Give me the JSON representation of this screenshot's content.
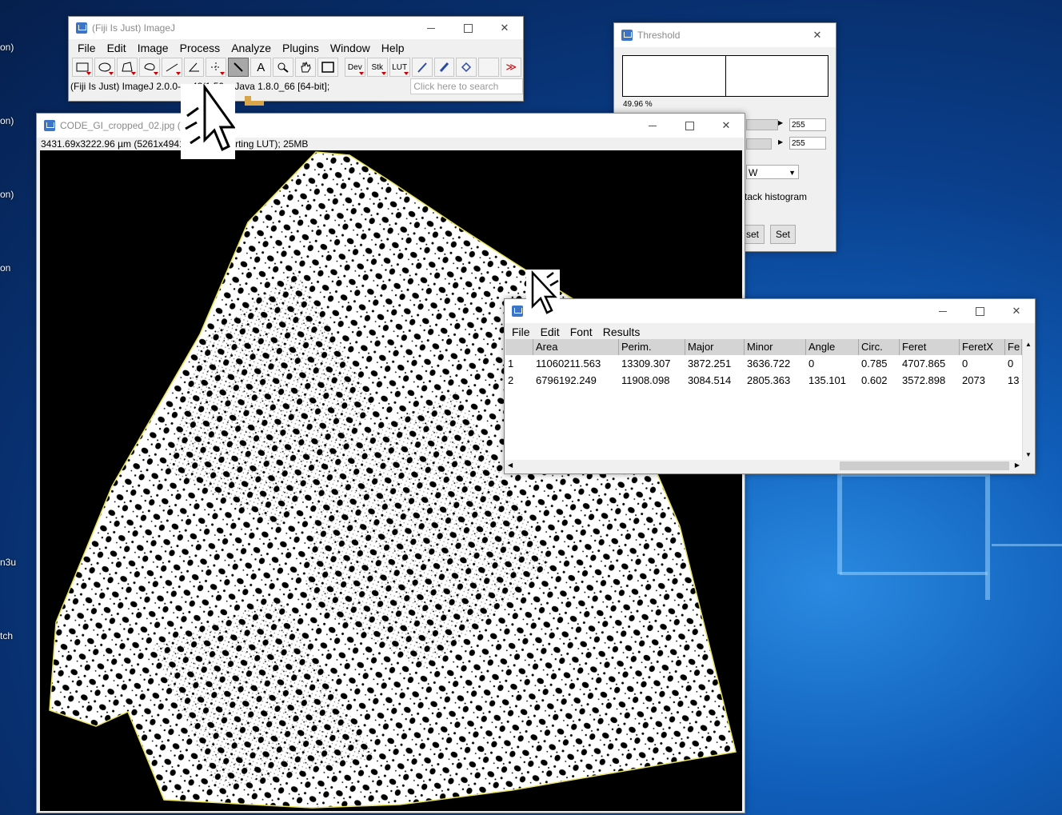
{
  "desktop": {
    "icon_labels": [
      "on)",
      "on)",
      "on)",
      "on",
      "n3u",
      "tch"
    ]
  },
  "imagej": {
    "title": "(Fiji Is Just) ImageJ",
    "menu": [
      "File",
      "Edit",
      "Image",
      "Process",
      "Analyze",
      "Plugins",
      "Window",
      "Help"
    ],
    "tools": {
      "rectangle": "rectangle-icon",
      "oval": "oval-icon",
      "polygon": "polygon-icon",
      "freehand": "freehand-icon",
      "line": "line-icon",
      "angle": "angle-icon",
      "point": "point-icon",
      "wand": "wand-icon",
      "text": "A",
      "magnifier": "magnifier-icon",
      "hand": "hand-icon",
      "color": "color-icon",
      "dev": "Dev",
      "stk": "Stk",
      "lut": "LUT",
      "pencil": "pencil-icon",
      "brush": "brush-icon",
      "flood": "flood-fill-icon",
      "more": "≫"
    },
    "status": "(Fiji Is Just) ImageJ 2.0.0-rc-43/1.50e; Java 1.8.0_66 [64-bit];",
    "search_placeholder": "Click here to search"
  },
  "image_window": {
    "title": "CODE_GI_cropped_02.jpg (G)",
    "info": "3431.69x3222.96 µm (5261x4941); 8-bit (inverting LUT); 25MB"
  },
  "threshold": {
    "title": "Threshold",
    "percent": "49.96 %",
    "value1": "255",
    "value2": "255",
    "method": "W",
    "stack_label": "tack histogram",
    "reset_label": "set",
    "set_label": "Set"
  },
  "results": {
    "menu": [
      "File",
      "Edit",
      "Font",
      "Results"
    ],
    "columns": [
      "",
      "Area",
      "Perim.",
      "Major",
      "Minor",
      "Angle",
      "Circ.",
      "Feret",
      "FeretX",
      "Fe"
    ],
    "rows": [
      [
        "1",
        "11060211.563",
        "13309.307",
        "3872.251",
        "3636.722",
        "0",
        "0.785",
        "4707.865",
        "0",
        "0"
      ],
      [
        "2",
        "6796192.249",
        "11908.098",
        "3084.514",
        "2805.363",
        "135.101",
        "0.602",
        "3572.898",
        "2073",
        "13"
      ]
    ]
  }
}
